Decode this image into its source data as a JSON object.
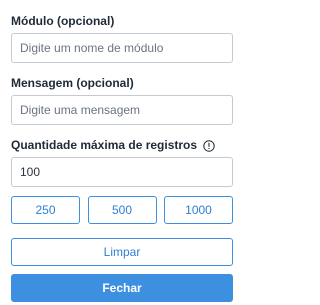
{
  "module": {
    "label": "Módulo (opcional)",
    "placeholder": "Digite um nome de módulo",
    "value": ""
  },
  "message": {
    "label": "Mensagem (opcional)",
    "placeholder": "Digite uma mensagem",
    "value": ""
  },
  "max_records": {
    "label": "Quantidade máxima de registros",
    "info_icon": "info-circle-icon",
    "value": "100",
    "presets": [
      "250",
      "500",
      "1000"
    ]
  },
  "actions": {
    "clear_label": "Limpar",
    "close_label": "Fechar"
  },
  "colors": {
    "accent": "#3d8fe0",
    "label_text": "#1f2a37",
    "input_border": "#c4cad1",
    "placeholder": "#6b7480"
  }
}
